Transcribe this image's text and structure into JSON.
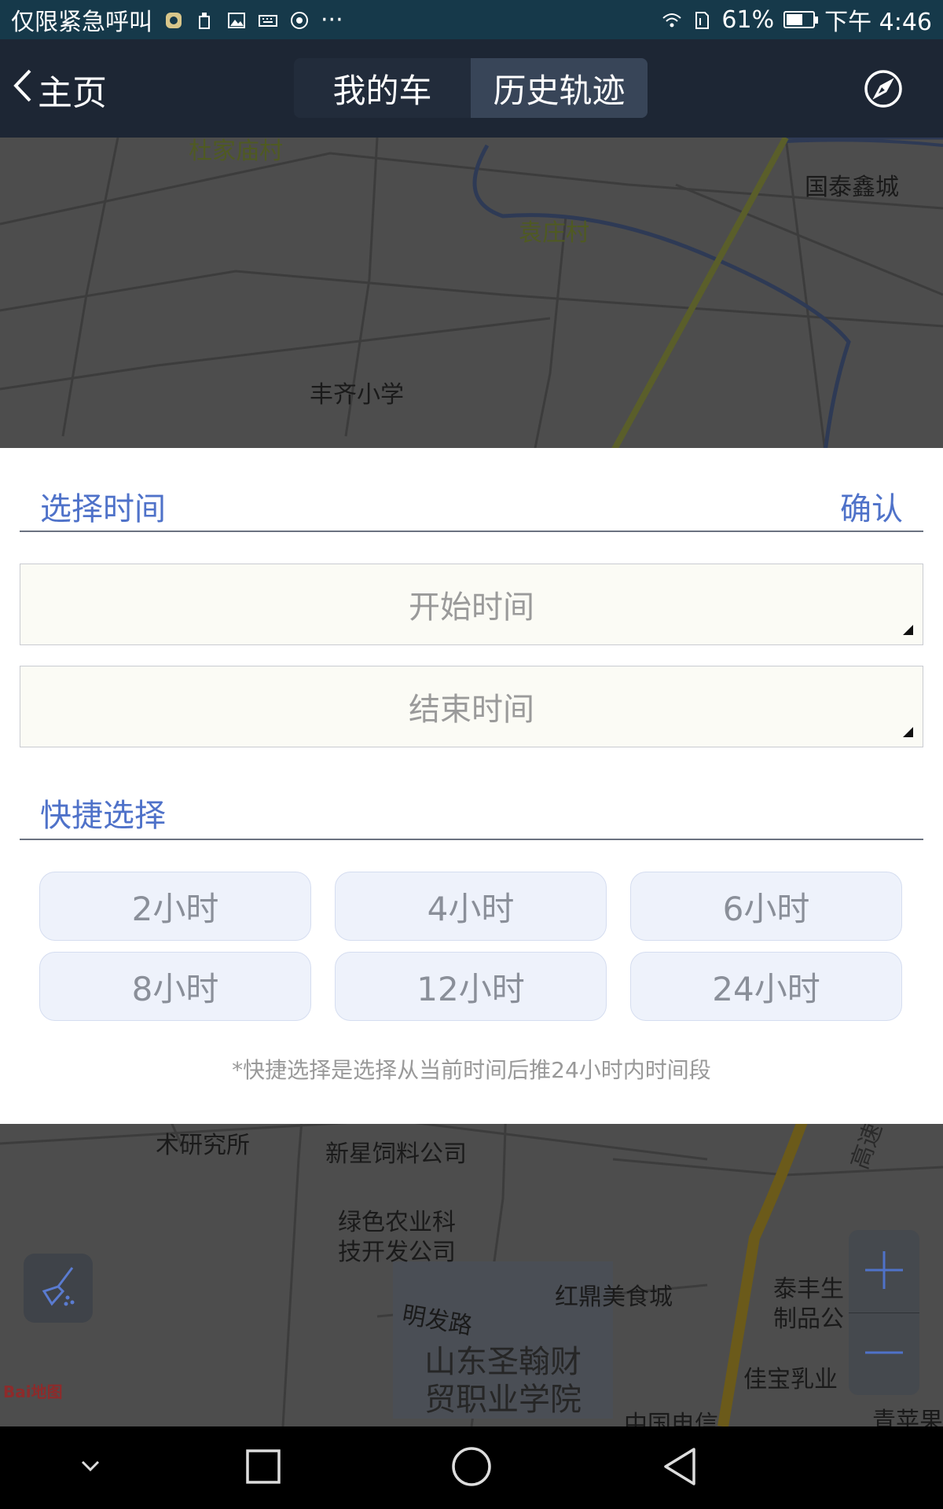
{
  "status_bar": {
    "carrier": "仅限紧急呼叫",
    "more": "···",
    "battery_percent": "61%",
    "battery_level": 0.61,
    "time": "下午 4:46"
  },
  "title_bar": {
    "back_label": "主页",
    "tabs": [
      {
        "label": "我的车",
        "active": false
      },
      {
        "label": "历史轨迹",
        "active": true
      }
    ]
  },
  "map": {
    "labels": [
      {
        "id": "l1",
        "text": "杜家庙村"
      },
      {
        "id": "l2",
        "text": "国泰鑫城"
      },
      {
        "id": "l3",
        "text": "袁庄村"
      },
      {
        "id": "l4",
        "text": "丰齐小学"
      },
      {
        "id": "l5",
        "text": "术研究所"
      },
      {
        "id": "l6",
        "text": "新星饲料公司"
      },
      {
        "id": "l7",
        "text": "绿色农业科"
      },
      {
        "id": "l8",
        "text": "技开发公司"
      },
      {
        "id": "l9",
        "text": "明发路"
      },
      {
        "id": "l10",
        "text": "红鼎美食城"
      },
      {
        "id": "l11",
        "text": "泰丰生"
      },
      {
        "id": "l12",
        "text": "制品公"
      },
      {
        "id": "l13",
        "text": "山东圣翰财"
      },
      {
        "id": "l14",
        "text": "贸职业学院"
      },
      {
        "id": "l15",
        "text": "佳宝乳业"
      },
      {
        "id": "l16",
        "text": "中国电信"
      },
      {
        "id": "l17",
        "text": "青苹果"
      },
      {
        "id": "l18",
        "text": "高速"
      }
    ],
    "logo": "Bai地图"
  },
  "panel": {
    "title": "选择时间",
    "confirm": "确认",
    "start_time_placeholder": "开始时间",
    "end_time_placeholder": "结束时间",
    "quick_title": "快捷选择",
    "quick_options": [
      "2小时",
      "4小时",
      "6小时",
      "8小时",
      "12小时",
      "24小时"
    ],
    "hint": "*快捷选择是选择从当前时间后推24小时内时间段"
  },
  "colors": {
    "accent": "#4f72c9",
    "status_bar": "#16394a",
    "title_bar": "#1d2634",
    "chip_bg": "#eef2fb"
  }
}
